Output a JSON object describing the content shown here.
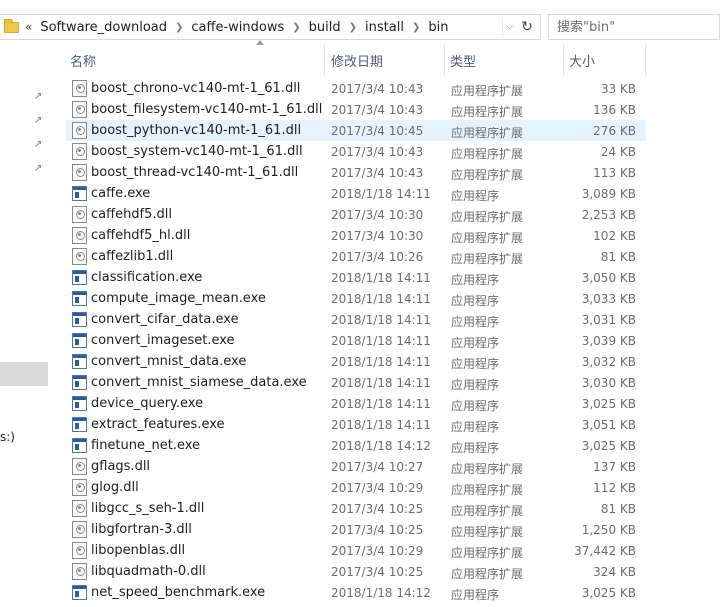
{
  "address_bar": {
    "more_glyph": "«",
    "breadcrumbs": [
      "Software_download",
      "caffe-windows",
      "build",
      "install",
      "bin"
    ]
  },
  "search": {
    "placeholder": "搜索\"bin\""
  },
  "nav_pane": {
    "fragment": "s:)"
  },
  "columns": {
    "name": "名称",
    "date": "修改日期",
    "type": "类型",
    "size": "大小"
  },
  "files": [
    {
      "name": "boost_chrono-vc140-mt-1_61.dll",
      "date": "2017/3/4 10:43",
      "type": "应用程序扩展",
      "size": "33 KB",
      "icon": "dll-file-icon"
    },
    {
      "name": "boost_filesystem-vc140-mt-1_61.dll",
      "date": "2017/3/4 10:43",
      "type": "应用程序扩展",
      "size": "136 KB",
      "icon": "dll-file-icon"
    },
    {
      "name": "boost_python-vc140-mt-1_61.dll",
      "date": "2017/3/4 10:45",
      "type": "应用程序扩展",
      "size": "276 KB",
      "icon": "dll-file-icon",
      "selected": true
    },
    {
      "name": "boost_system-vc140-mt-1_61.dll",
      "date": "2017/3/4 10:43",
      "type": "应用程序扩展",
      "size": "24 KB",
      "icon": "dll-file-icon"
    },
    {
      "name": "boost_thread-vc140-mt-1_61.dll",
      "date": "2017/3/4 10:43",
      "type": "应用程序扩展",
      "size": "113 KB",
      "icon": "dll-file-icon"
    },
    {
      "name": "caffe.exe",
      "date": "2018/1/18 14:11",
      "type": "应用程序",
      "size": "3,089 KB",
      "icon": "exe-file-icon"
    },
    {
      "name": "caffehdf5.dll",
      "date": "2017/3/4 10:30",
      "type": "应用程序扩展",
      "size": "2,253 KB",
      "icon": "dll-file-icon"
    },
    {
      "name": "caffehdf5_hl.dll",
      "date": "2017/3/4 10:30",
      "type": "应用程序扩展",
      "size": "102 KB",
      "icon": "dll-file-icon"
    },
    {
      "name": "caffezlib1.dll",
      "date": "2017/3/4 10:26",
      "type": "应用程序扩展",
      "size": "81 KB",
      "icon": "dll-file-icon"
    },
    {
      "name": "classification.exe",
      "date": "2018/1/18 14:11",
      "type": "应用程序",
      "size": "3,050 KB",
      "icon": "exe-file-icon"
    },
    {
      "name": "compute_image_mean.exe",
      "date": "2018/1/18 14:11",
      "type": "应用程序",
      "size": "3,033 KB",
      "icon": "exe-file-icon"
    },
    {
      "name": "convert_cifar_data.exe",
      "date": "2018/1/18 14:11",
      "type": "应用程序",
      "size": "3,031 KB",
      "icon": "exe-file-icon"
    },
    {
      "name": "convert_imageset.exe",
      "date": "2018/1/18 14:11",
      "type": "应用程序",
      "size": "3,039 KB",
      "icon": "exe-file-icon"
    },
    {
      "name": "convert_mnist_data.exe",
      "date": "2018/1/18 14:11",
      "type": "应用程序",
      "size": "3,032 KB",
      "icon": "exe-file-icon"
    },
    {
      "name": "convert_mnist_siamese_data.exe",
      "date": "2018/1/18 14:11",
      "type": "应用程序",
      "size": "3,030 KB",
      "icon": "exe-file-icon"
    },
    {
      "name": "device_query.exe",
      "date": "2018/1/18 14:11",
      "type": "应用程序",
      "size": "3,025 KB",
      "icon": "exe-file-icon"
    },
    {
      "name": "extract_features.exe",
      "date": "2018/1/18 14:11",
      "type": "应用程序",
      "size": "3,051 KB",
      "icon": "exe-file-icon"
    },
    {
      "name": "finetune_net.exe",
      "date": "2018/1/18 14:12",
      "type": "应用程序",
      "size": "3,025 KB",
      "icon": "exe-file-icon"
    },
    {
      "name": "gflags.dll",
      "date": "2017/3/4 10:27",
      "type": "应用程序扩展",
      "size": "137 KB",
      "icon": "dll-file-icon"
    },
    {
      "name": "glog.dll",
      "date": "2017/3/4 10:29",
      "type": "应用程序扩展",
      "size": "112 KB",
      "icon": "dll-file-icon"
    },
    {
      "name": "libgcc_s_seh-1.dll",
      "date": "2017/3/4 10:25",
      "type": "应用程序扩展",
      "size": "81 KB",
      "icon": "dll-file-icon"
    },
    {
      "name": "libgfortran-3.dll",
      "date": "2017/3/4 10:25",
      "type": "应用程序扩展",
      "size": "1,250 KB",
      "icon": "dll-file-icon"
    },
    {
      "name": "libopenblas.dll",
      "date": "2017/3/4 10:29",
      "type": "应用程序扩展",
      "size": "37,442 KB",
      "icon": "dll-file-icon"
    },
    {
      "name": "libquadmath-0.dll",
      "date": "2017/3/4 10:25",
      "type": "应用程序扩展",
      "size": "324 KB",
      "icon": "dll-file-icon"
    },
    {
      "name": "net_speed_benchmark.exe",
      "date": "2018/1/18 14:12",
      "type": "应用程序",
      "size": "3,025 KB",
      "icon": "exe-file-icon"
    }
  ],
  "colors": {
    "selection": "#e5f3ff",
    "header_text": "#4c607a",
    "secondary_text": "#6d6d6d"
  }
}
